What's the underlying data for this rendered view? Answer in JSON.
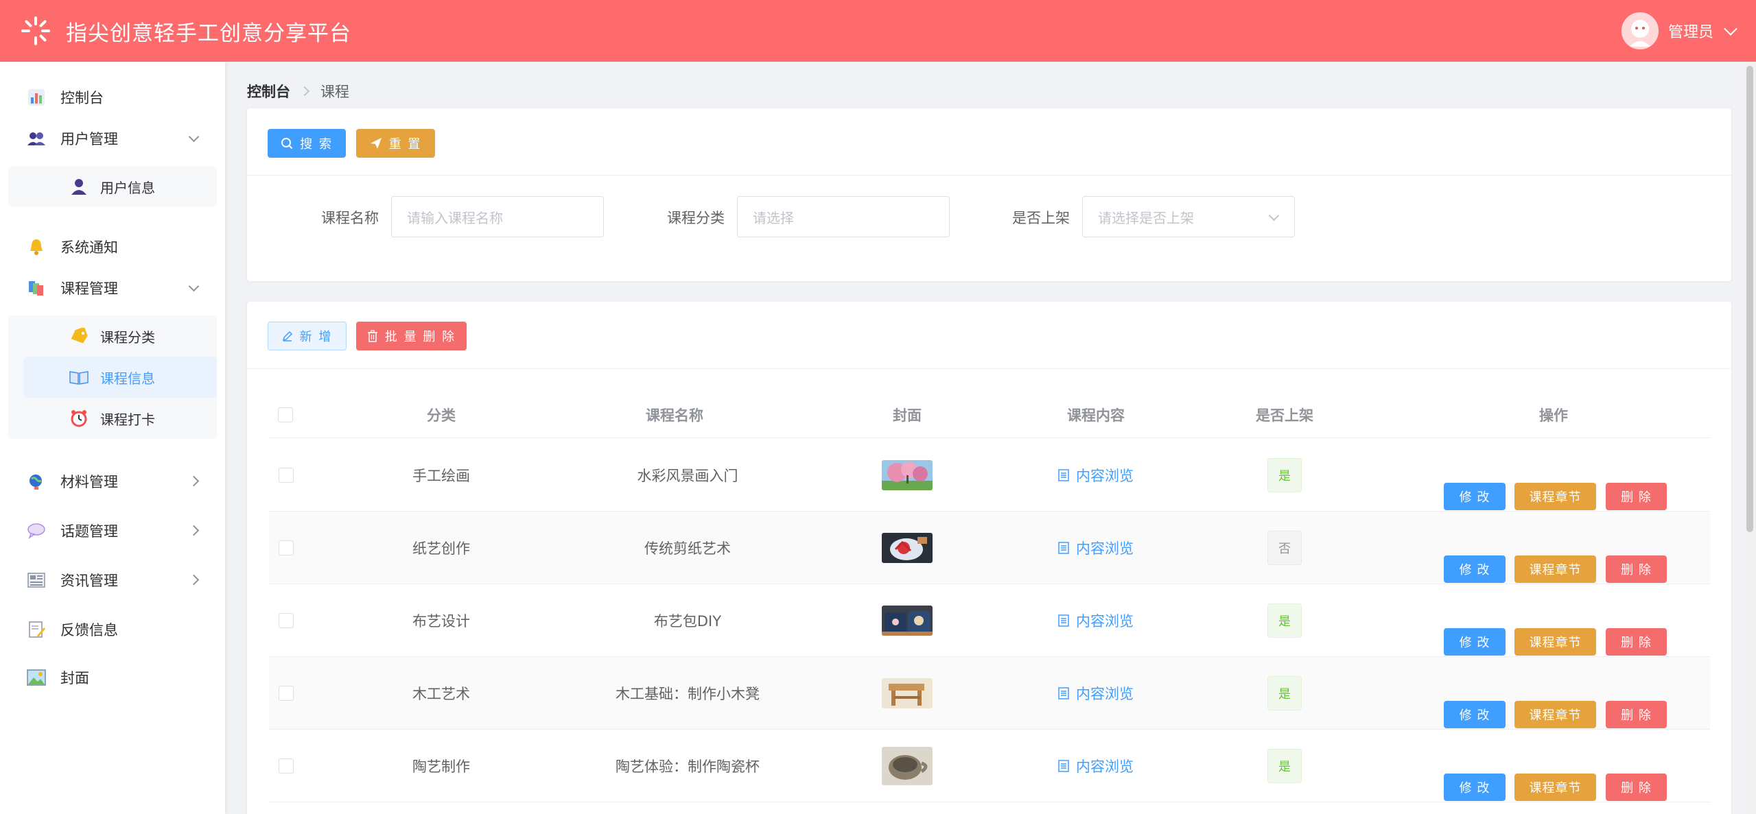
{
  "header": {
    "title": "指尖创意轻手工创意分享平台",
    "user_name": "管理员"
  },
  "sidebar": {
    "items": [
      {
        "label": "控制台",
        "icon": "dashboard-chart-icon"
      },
      {
        "label": "用户管理",
        "icon": "users-icon"
      },
      {
        "label": "用户信息",
        "icon": "user-icon"
      },
      {
        "label": "系统通知",
        "icon": "bell-icon"
      },
      {
        "label": "课程管理",
        "icon": "books-icon"
      },
      {
        "label": "课程分类",
        "icon": "tag-icon"
      },
      {
        "label": "课程信息",
        "icon": "book-icon"
      },
      {
        "label": "课程打卡",
        "icon": "alarm-clock-icon"
      },
      {
        "label": "材料管理",
        "icon": "globe-icon"
      },
      {
        "label": "话题管理",
        "icon": "speech-bubble-icon"
      },
      {
        "label": "资讯管理",
        "icon": "newspaper-icon"
      },
      {
        "label": "反馈信息",
        "icon": "memo-icon"
      },
      {
        "label": "封面",
        "icon": "picture-icon"
      }
    ]
  },
  "breadcrumb": {
    "root": "控制台",
    "current": "课程"
  },
  "search": {
    "search_label": "搜 索",
    "reset_label": "重 置",
    "fields": [
      {
        "label": "课程名称",
        "placeholder": "请输入课程名称"
      },
      {
        "label": "课程分类",
        "placeholder": "请选择"
      },
      {
        "label": "是否上架",
        "placeholder": "请选择是否上架"
      }
    ]
  },
  "toolbar": {
    "add_label": "新 增",
    "batch_delete_label": "批 量 删 除"
  },
  "table": {
    "headers": [
      "分类",
      "课程名称",
      "封面",
      "课程内容",
      "是否上架",
      "操作"
    ],
    "link_label": "内容浏览",
    "edit_label": "修 改",
    "chapter_label": "课程章节",
    "delete_label": "删 除",
    "rows": [
      {
        "category": "手工绘画",
        "name": "水彩风景画入门",
        "listed": "是"
      },
      {
        "category": "纸艺创作",
        "name": "传统剪纸艺术",
        "listed": "否"
      },
      {
        "category": "布艺设计",
        "name": "布艺包DIY",
        "listed": "是"
      },
      {
        "category": "木工艺术",
        "name": "木工基础：制作小木凳",
        "listed": "是"
      },
      {
        "category": "陶艺制作",
        "name": "陶艺体验：制作陶瓷杯",
        "listed": "是"
      }
    ]
  },
  "colors": {
    "header": "#fd6b6c",
    "primary": "#409eff",
    "warning": "#e6a23c",
    "danger": "#f56c6c"
  }
}
